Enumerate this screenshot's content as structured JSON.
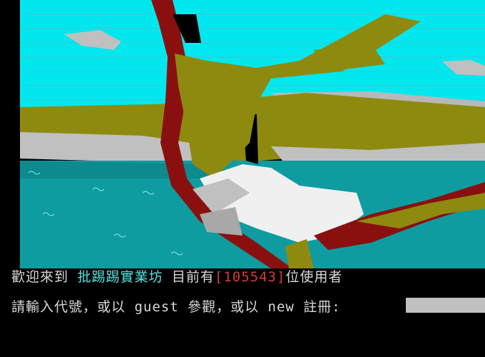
{
  "banner": {
    "colors": {
      "sky": "#00e8ee",
      "sky_lines": "#46c0d8",
      "cloud": "#c0c0c0",
      "ground": "#8e8a10",
      "water": "#0e9ca0",
      "branch": "#8a1010",
      "white": "#f0f0f0",
      "black": "#000000"
    }
  },
  "welcome": {
    "prefix": "歡迎來到 ",
    "site_name": "批踢踢實業坊",
    "middle": " 目前有",
    "user_count": "[105543]",
    "suffix": "位使用者"
  },
  "login": {
    "prompt": "請輸入代號，或以 guest 參觀，或以 new 註冊: ",
    "input_value": ""
  }
}
